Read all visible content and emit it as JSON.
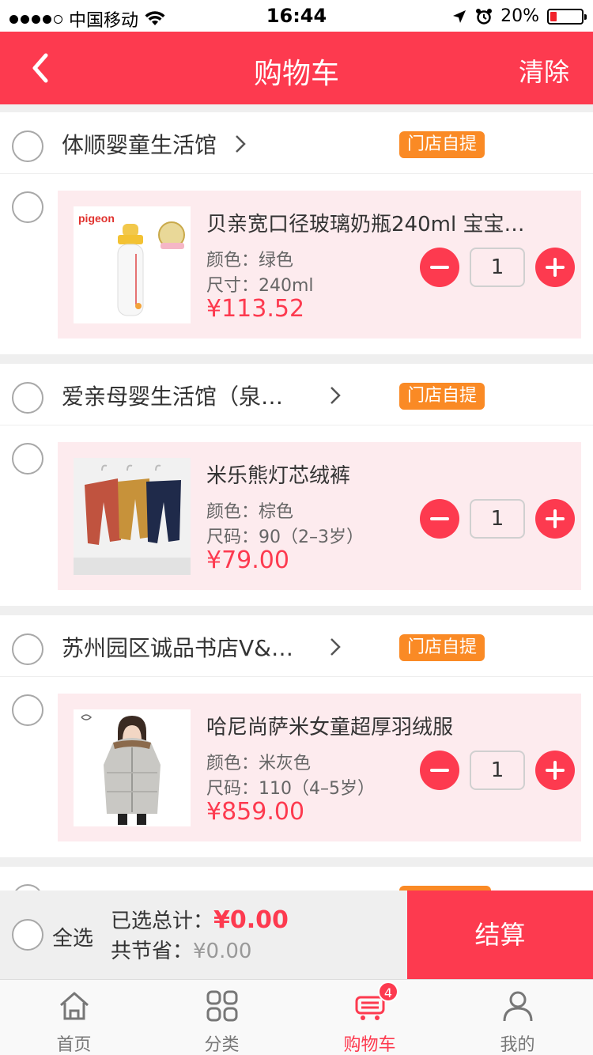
{
  "status_bar": {
    "carrier": "中国移动",
    "time": "16:44",
    "battery": "20%"
  },
  "nav": {
    "title": "购物车",
    "clear_label": "清除"
  },
  "shops": [
    {
      "name": "体顺婴童生活馆",
      "pickup_tag": "门店自提",
      "item": {
        "title": "贝亲宽口径玻璃奶瓶240ml 宝宝…",
        "attr1": "颜色：绿色",
        "attr2": "尺寸：240ml",
        "price": "¥113.52",
        "qty": "1",
        "thumb_brand": "pigeon"
      }
    },
    {
      "name": "爱亲母婴生活馆（泉…",
      "pickup_tag": "门店自提",
      "item": {
        "title": "米乐熊灯芯绒裤",
        "attr1": "颜色：棕色",
        "attr2": "尺码：90（2–3岁）",
        "price": "¥79.00",
        "qty": "1"
      }
    },
    {
      "name": "苏州园区诚品书店V&…",
      "pickup_tag": "门店自提",
      "item": {
        "title": "哈尼尚萨米女童超厚羽绒服",
        "attr1": "颜色：米灰色",
        "attr2": "尺码：110（4–5岁）",
        "price": "¥859.00",
        "qty": "1"
      }
    }
  ],
  "checkout": {
    "select_all": "全选",
    "total_label": "已选总计：",
    "total_amount": "¥0.00",
    "save_label": "共节省：",
    "save_amount": "¥0.00",
    "checkout_label": "结算"
  },
  "tabs": [
    {
      "label": "首页",
      "icon": "home-icon"
    },
    {
      "label": "分类",
      "icon": "category-icon"
    },
    {
      "label": "购物车",
      "icon": "cart-icon",
      "badge": "4"
    },
    {
      "label": "我的",
      "icon": "profile-icon"
    }
  ],
  "colors": {
    "accent": "#fd3a4f",
    "tag": "#fa8a25",
    "card": "#fdebee"
  }
}
